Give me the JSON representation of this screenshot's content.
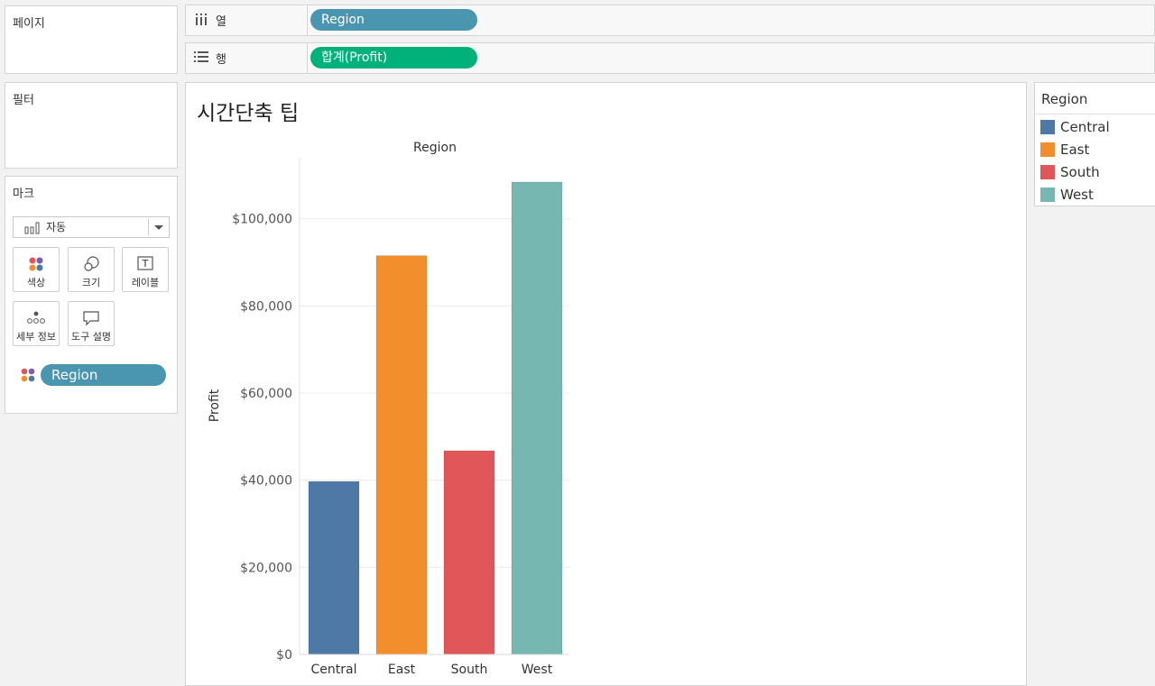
{
  "cards": {
    "pages_title": "페이지",
    "filters_title": "필터",
    "marks_title": "마크",
    "mark_type": "자동",
    "mark_buttons": {
      "color": "색상",
      "size": "크기",
      "label": "레이블",
      "detail": "세부 정보",
      "tooltip": "도구 설명"
    },
    "color_pill": "Region"
  },
  "shelves": {
    "columns_label": "열",
    "columns_pill": "Region",
    "rows_label": "행",
    "rows_pill": "합계(Profit)"
  },
  "view": {
    "title": "시간단축 팁"
  },
  "legend": {
    "title": "Region",
    "items": [
      "Central",
      "East",
      "South",
      "West"
    ]
  },
  "colors": {
    "Central": "#4e79a7",
    "East": "#f28e2b",
    "South": "#e15759",
    "West": "#76b7b2",
    "columns_pill": "#4a96b1",
    "rows_pill": "#00b27a"
  },
  "chart_data": {
    "type": "bar",
    "title": "Region",
    "xlabel": "",
    "ylabel": "Profit",
    "categories": [
      "Central",
      "East",
      "South",
      "West"
    ],
    "values": [
      39706,
      91523,
      46750,
      108418
    ],
    "yticks": [
      0,
      20000,
      40000,
      60000,
      80000,
      100000
    ],
    "ytick_labels": [
      "$0",
      "$20,000",
      "$40,000",
      "$60,000",
      "$80,000",
      "$100,000"
    ],
    "ylim": [
      0,
      114000
    ],
    "grid": true,
    "legend": "right"
  }
}
